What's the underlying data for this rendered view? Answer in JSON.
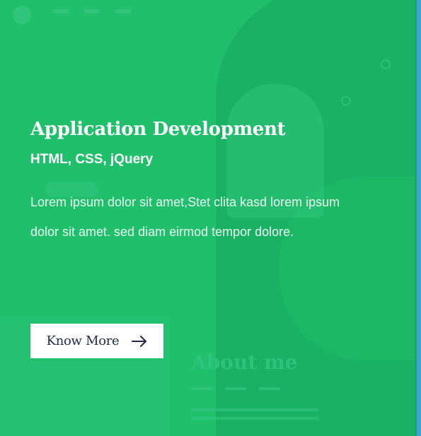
{
  "card": {
    "title": "Application Development",
    "subtitle": "HTML, CSS, jQuery",
    "description": "Lorem ipsum dolor sit amet,Stet clita kasd lorem ipsum dolor sit amet. sed diam eirmod tempor dolore.",
    "button_label": "Know More",
    "button_icon": "arrow-right-icon"
  },
  "background": {
    "heading": "About me"
  },
  "colors": {
    "overlay": "#1fbf6c",
    "button_bg": "#ffffff",
    "button_text": "#1f2a4a",
    "text": "#ffffff"
  }
}
